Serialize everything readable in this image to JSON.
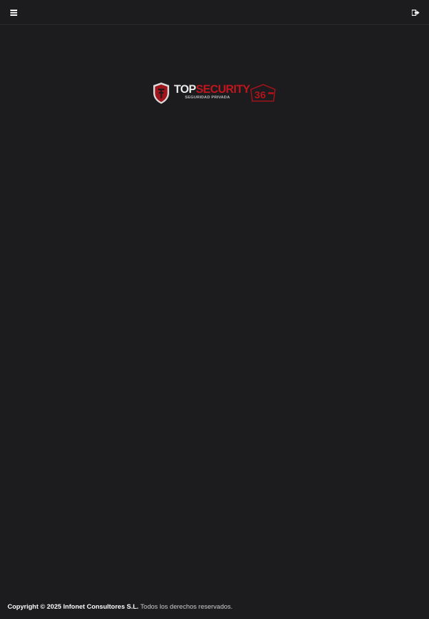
{
  "header": {
    "menu_icon": "hamburger-menu-icon",
    "logout_icon": "logout-icon"
  },
  "logo": {
    "brand_top": "TOP",
    "brand_security": "SECURITY",
    "brand_sub": "SEGURIDAD PRIVADA",
    "years_badge": "36"
  },
  "footer": {
    "copyright": "Copyright © 2025 Infonet Consultores S.L.",
    "rights": "Todos los derechos reservados."
  },
  "colors": {
    "background": "#1c1b1e",
    "brand_red": "#c0161d",
    "text_light": "#e9e9e9"
  }
}
